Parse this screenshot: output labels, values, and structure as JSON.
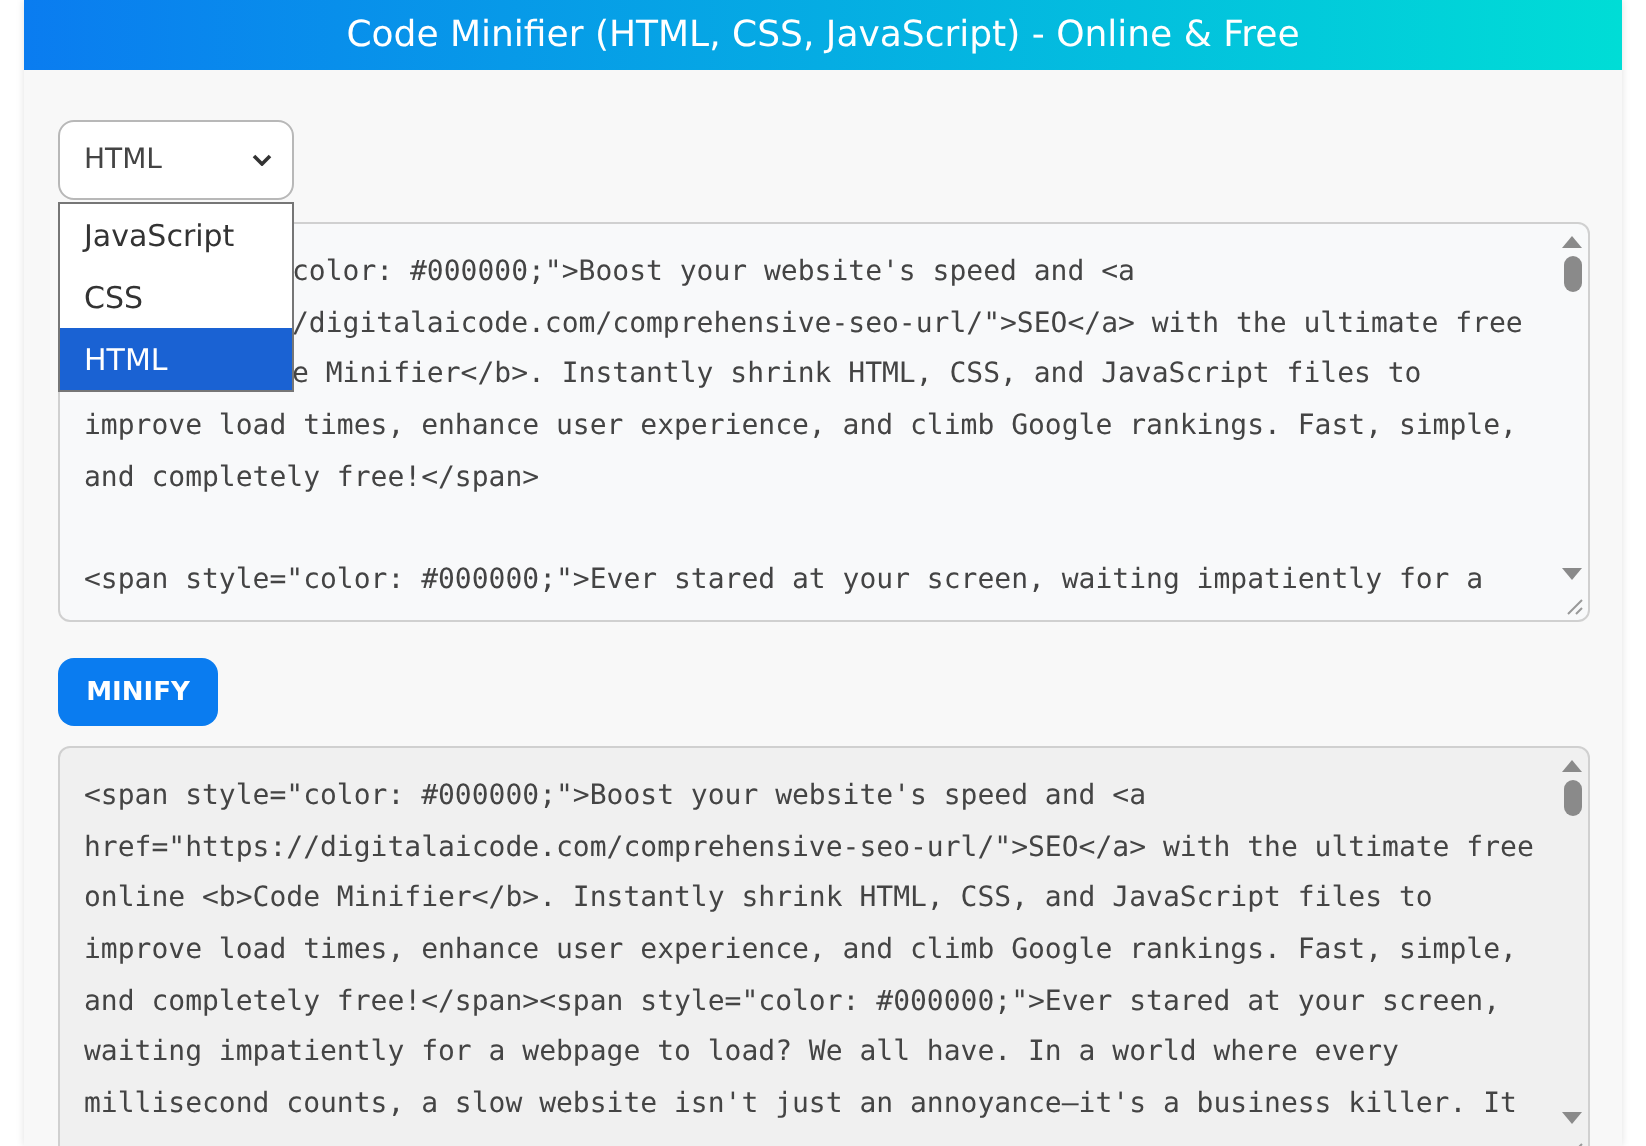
{
  "header": {
    "title": "Code Minifier (HTML, CSS, JavaScript) - Online & Free"
  },
  "language_select": {
    "value": "HTML",
    "expanded": true,
    "options": [
      {
        "label": "JavaScript",
        "selected": false
      },
      {
        "label": "CSS",
        "selected": false
      },
      {
        "label": "HTML",
        "selected": true
      }
    ]
  },
  "input_editor": {
    "lines_behind_dropdown": [
      "color: #000000;\">Boost your website's speed and <a",
      "/digitalaicode.com/comprehensive-seo-url/\">SEO</a> with the ultimate free",
      "e Minifier</b>. Instantly shrink HTML, CSS, and JavaScript files to"
    ],
    "lines": [
      "improve load times, enhance user experience, and climb Google rankings. Fast, simple,",
      "and completely free!</span>"
    ],
    "next_paragraph_lines": [
      "<span style=\"color: #000000;\">Ever stared at your screen, waiting impatiently for a"
    ]
  },
  "minify_button": {
    "label": "MINIFY"
  },
  "output_editor": {
    "lines": [
      "<span style=\"color: #000000;\">Boost your website's speed and <a",
      "href=\"https://digitalaicode.com/comprehensive-seo-url/\">SEO</a> with the ultimate free",
      "online <b>Code Minifier</b>. Instantly shrink HTML, CSS, and JavaScript files to",
      "improve load times, enhance user experience, and climb Google rankings. Fast, simple,",
      "and completely free!</span><span style=\"color: #000000;\">Ever stared at your screen,",
      "waiting impatiently for a webpage to load? We all have. In a world where every",
      "millisecond counts, a slow website isn't just an annoyance—it's a business killer. It"
    ]
  }
}
